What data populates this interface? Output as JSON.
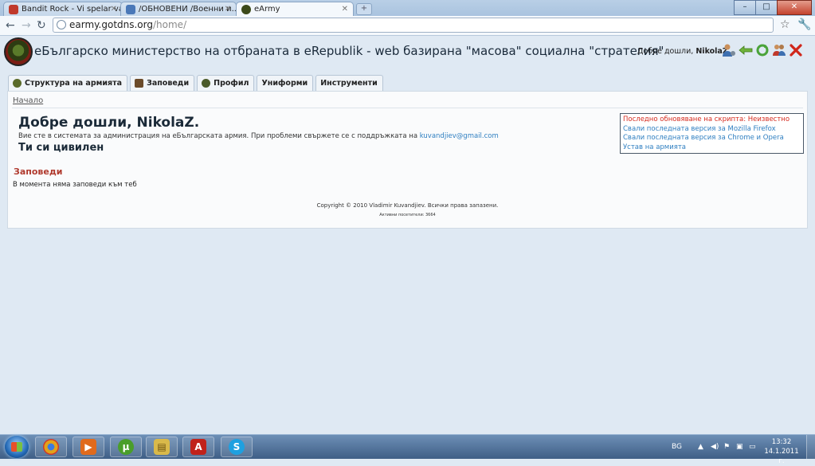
{
  "browser": {
    "tabs": [
      {
        "label": "Bandit Rock - Vi spelar va...",
        "active": false,
        "favicon_color": "#c0392b"
      },
      {
        "label": "/ОБНОВЕНИ /Военни и...",
        "active": false,
        "favicon_color": "#4a78b8"
      },
      {
        "label": "eArmy",
        "active": true,
        "favicon_color": "#3c4a1a"
      }
    ],
    "new_tab": "+",
    "window_buttons": {
      "minimize": "–",
      "maximize": "□",
      "close": "✕"
    },
    "back": "←",
    "forward": "→",
    "reload": "↻",
    "url_host": "earmy.gotdns.org",
    "url_path": "/home/",
    "star": "☆",
    "wrench": "🔧"
  },
  "header": {
    "title": "eБългарско министерство на отбраната в eRepublik - web базирана \"масова\" социална \"стратегия\"",
    "welcome_prefix": "Добре дошли,",
    "username": "NikolaZ.",
    "icons": [
      "user-settings-icon",
      "back-arrow-icon",
      "refresh-icon",
      "group-icon",
      "close-icon"
    ]
  },
  "nav": {
    "tabs": [
      {
        "label": "Структура на армията",
        "color": "#5b6b2a"
      },
      {
        "label": "Заповеди",
        "color": "#6b4b2a"
      },
      {
        "label": "Профил",
        "color": "#4b5b2a"
      },
      {
        "label": "Униформи",
        "color": ""
      },
      {
        "label": "Инструменти",
        "color": ""
      }
    ]
  },
  "content": {
    "breadcrumb": "Начало",
    "welcome_heading": "Добре дошли, NikolaZ.",
    "intro_text": "Вие сте в системата за администрация на eБългарската армия. При проблеми свържете се с поддръжката на",
    "support_email": "kuvandjiev@gmail.com",
    "status_heading": "Ти си цивилен",
    "orders_heading": "Заповеди",
    "orders_empty": "В момента няма заповеди към теб",
    "infobox": {
      "last_update": "Последно обновяване на скрипта: Неизвестно",
      "links": [
        "Свали последната версия за Mozilla Firefox",
        "Свали последната версия за Chrome и Opera",
        "Устав на армията"
      ]
    }
  },
  "footer": {
    "copyright": "Copyright © 2010 Vladimir Kuvandjiev. Всички права запазени.",
    "visitors": "Активни посетители: 3664"
  },
  "taskbar": {
    "apps": [
      {
        "name": "chrome",
        "color": "#e2a21b",
        "glyph": "◉"
      },
      {
        "name": "media-player",
        "color": "#e06a1c",
        "glyph": "▶"
      },
      {
        "name": "utorrent",
        "color": "#4a9e2a",
        "glyph": "µ"
      },
      {
        "name": "explorer",
        "color": "#d9b94a",
        "glyph": "▤"
      },
      {
        "name": "acrobat",
        "color": "#c0221a",
        "glyph": "A"
      },
      {
        "name": "skype",
        "color": "#1ea0e0",
        "glyph": "S"
      }
    ],
    "language": "BG",
    "time": "13:32",
    "date": "14.1.2011 г."
  }
}
